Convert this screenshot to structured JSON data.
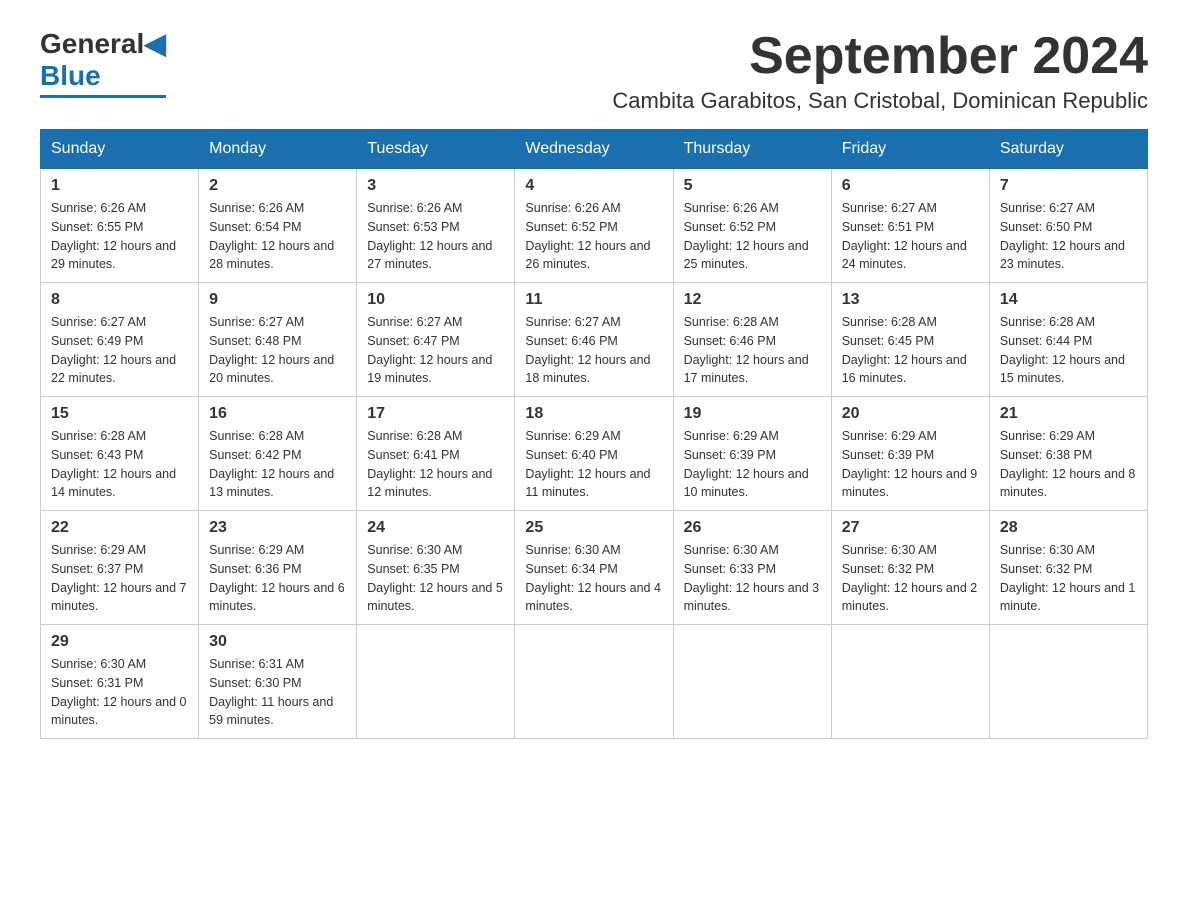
{
  "header": {
    "logo_general": "General",
    "logo_blue": "Blue",
    "month_title": "September 2024",
    "location": "Cambita Garabitos, San Cristobal, Dominican Republic"
  },
  "days_of_week": [
    "Sunday",
    "Monday",
    "Tuesday",
    "Wednesday",
    "Thursday",
    "Friday",
    "Saturday"
  ],
  "weeks": [
    [
      {
        "day": "1",
        "sunrise": "6:26 AM",
        "sunset": "6:55 PM",
        "daylight": "12 hours and 29 minutes."
      },
      {
        "day": "2",
        "sunrise": "6:26 AM",
        "sunset": "6:54 PM",
        "daylight": "12 hours and 28 minutes."
      },
      {
        "day": "3",
        "sunrise": "6:26 AM",
        "sunset": "6:53 PM",
        "daylight": "12 hours and 27 minutes."
      },
      {
        "day": "4",
        "sunrise": "6:26 AM",
        "sunset": "6:52 PM",
        "daylight": "12 hours and 26 minutes."
      },
      {
        "day": "5",
        "sunrise": "6:26 AM",
        "sunset": "6:52 PM",
        "daylight": "12 hours and 25 minutes."
      },
      {
        "day": "6",
        "sunrise": "6:27 AM",
        "sunset": "6:51 PM",
        "daylight": "12 hours and 24 minutes."
      },
      {
        "day": "7",
        "sunrise": "6:27 AM",
        "sunset": "6:50 PM",
        "daylight": "12 hours and 23 minutes."
      }
    ],
    [
      {
        "day": "8",
        "sunrise": "6:27 AM",
        "sunset": "6:49 PM",
        "daylight": "12 hours and 22 minutes."
      },
      {
        "day": "9",
        "sunrise": "6:27 AM",
        "sunset": "6:48 PM",
        "daylight": "12 hours and 20 minutes."
      },
      {
        "day": "10",
        "sunrise": "6:27 AM",
        "sunset": "6:47 PM",
        "daylight": "12 hours and 19 minutes."
      },
      {
        "day": "11",
        "sunrise": "6:27 AM",
        "sunset": "6:46 PM",
        "daylight": "12 hours and 18 minutes."
      },
      {
        "day": "12",
        "sunrise": "6:28 AM",
        "sunset": "6:46 PM",
        "daylight": "12 hours and 17 minutes."
      },
      {
        "day": "13",
        "sunrise": "6:28 AM",
        "sunset": "6:45 PM",
        "daylight": "12 hours and 16 minutes."
      },
      {
        "day": "14",
        "sunrise": "6:28 AM",
        "sunset": "6:44 PM",
        "daylight": "12 hours and 15 minutes."
      }
    ],
    [
      {
        "day": "15",
        "sunrise": "6:28 AM",
        "sunset": "6:43 PM",
        "daylight": "12 hours and 14 minutes."
      },
      {
        "day": "16",
        "sunrise": "6:28 AM",
        "sunset": "6:42 PM",
        "daylight": "12 hours and 13 minutes."
      },
      {
        "day": "17",
        "sunrise": "6:28 AM",
        "sunset": "6:41 PM",
        "daylight": "12 hours and 12 minutes."
      },
      {
        "day": "18",
        "sunrise": "6:29 AM",
        "sunset": "6:40 PM",
        "daylight": "12 hours and 11 minutes."
      },
      {
        "day": "19",
        "sunrise": "6:29 AM",
        "sunset": "6:39 PM",
        "daylight": "12 hours and 10 minutes."
      },
      {
        "day": "20",
        "sunrise": "6:29 AM",
        "sunset": "6:39 PM",
        "daylight": "12 hours and 9 minutes."
      },
      {
        "day": "21",
        "sunrise": "6:29 AM",
        "sunset": "6:38 PM",
        "daylight": "12 hours and 8 minutes."
      }
    ],
    [
      {
        "day": "22",
        "sunrise": "6:29 AM",
        "sunset": "6:37 PM",
        "daylight": "12 hours and 7 minutes."
      },
      {
        "day": "23",
        "sunrise": "6:29 AM",
        "sunset": "6:36 PM",
        "daylight": "12 hours and 6 minutes."
      },
      {
        "day": "24",
        "sunrise": "6:30 AM",
        "sunset": "6:35 PM",
        "daylight": "12 hours and 5 minutes."
      },
      {
        "day": "25",
        "sunrise": "6:30 AM",
        "sunset": "6:34 PM",
        "daylight": "12 hours and 4 minutes."
      },
      {
        "day": "26",
        "sunrise": "6:30 AM",
        "sunset": "6:33 PM",
        "daylight": "12 hours and 3 minutes."
      },
      {
        "day": "27",
        "sunrise": "6:30 AM",
        "sunset": "6:32 PM",
        "daylight": "12 hours and 2 minutes."
      },
      {
        "day": "28",
        "sunrise": "6:30 AM",
        "sunset": "6:32 PM",
        "daylight": "12 hours and 1 minute."
      }
    ],
    [
      {
        "day": "29",
        "sunrise": "6:30 AM",
        "sunset": "6:31 PM",
        "daylight": "12 hours and 0 minutes."
      },
      {
        "day": "30",
        "sunrise": "6:31 AM",
        "sunset": "6:30 PM",
        "daylight": "11 hours and 59 minutes."
      },
      null,
      null,
      null,
      null,
      null
    ]
  ]
}
